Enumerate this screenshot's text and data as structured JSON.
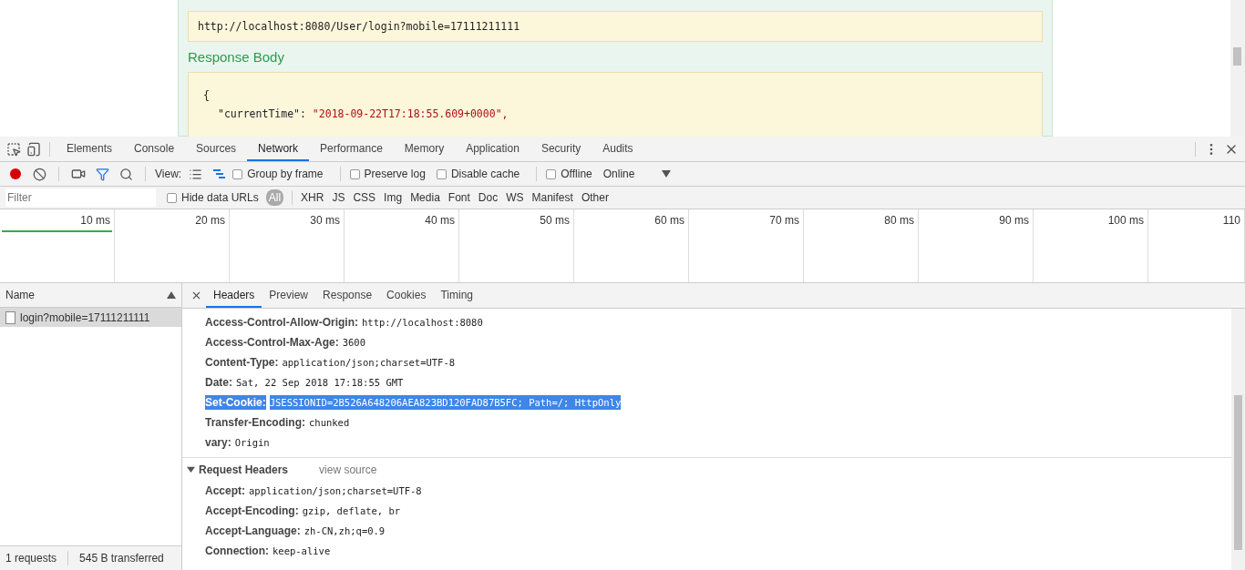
{
  "page": {
    "url": "http://localhost:8080/User/login?mobile=17111211111",
    "section_title": "Response Body",
    "code_open": "{",
    "code_key": "\"currentTime\": ",
    "code_value": "\"2018-09-22T17:18:55.609+0000\","
  },
  "devtools": {
    "tabs": [
      {
        "label": "Elements",
        "selected": false
      },
      {
        "label": "Console",
        "selected": false
      },
      {
        "label": "Sources",
        "selected": false
      },
      {
        "label": "Network",
        "selected": true
      },
      {
        "label": "Performance",
        "selected": false
      },
      {
        "label": "Memory",
        "selected": false
      },
      {
        "label": "Application",
        "selected": false
      },
      {
        "label": "Security",
        "selected": false
      },
      {
        "label": "Audits",
        "selected": false
      }
    ],
    "toolbar": {
      "recording": true,
      "filter_on": true,
      "view_label": "View:",
      "options": [
        {
          "label": "Group by frame",
          "checked": false
        },
        {
          "label": "Preserve log",
          "checked": false
        },
        {
          "label": "Disable cache",
          "checked": false
        },
        {
          "label": "Offline",
          "checked": false
        }
      ],
      "throttle": "Online"
    },
    "filter_bar": {
      "placeholder": "Filter",
      "hide_data_urls": {
        "label": "Hide data URLs",
        "checked": false
      },
      "types": [
        {
          "label": "All",
          "selected": true
        },
        {
          "label": "XHR",
          "selected": false
        },
        {
          "label": "JS",
          "selected": false
        },
        {
          "label": "CSS",
          "selected": false
        },
        {
          "label": "Img",
          "selected": false
        },
        {
          "label": "Media",
          "selected": false
        },
        {
          "label": "Font",
          "selected": false
        },
        {
          "label": "Doc",
          "selected": false
        },
        {
          "label": "WS",
          "selected": false
        },
        {
          "label": "Manifest",
          "selected": false
        },
        {
          "label": "Other",
          "selected": false
        }
      ]
    },
    "timeline": {
      "ticks": [
        "10 ms",
        "20 ms",
        "30 ms",
        "40 ms",
        "50 ms",
        "60 ms",
        "70 ms",
        "80 ms",
        "90 ms",
        "100 ms",
        "110"
      ]
    },
    "requests": {
      "column": "Name",
      "rows": [
        {
          "name": "login?mobile=17111211111",
          "selected": true
        }
      ]
    },
    "status": {
      "requests": "1 requests",
      "transferred": "545 B transferred"
    },
    "detail_tabs": [
      {
        "label": "Headers",
        "selected": true
      },
      {
        "label": "Preview",
        "selected": false
      },
      {
        "label": "Response",
        "selected": false
      },
      {
        "label": "Cookies",
        "selected": false
      },
      {
        "label": "Timing",
        "selected": false
      }
    ],
    "response_headers": [
      {
        "name": "Access-Control-Allow-Origin:",
        "value": "http://localhost:8080",
        "selected": false
      },
      {
        "name": "Access-Control-Max-Age:",
        "value": "3600",
        "selected": false
      },
      {
        "name": "Content-Type:",
        "value": "application/json;charset=UTF-8",
        "selected": false
      },
      {
        "name": "Date:",
        "value": "Sat, 22 Sep 2018 17:18:55 GMT",
        "selected": false
      },
      {
        "name": "Set-Cookie:",
        "value": "JSESSIONID=2B526A648206AEA823BD120FAD87B5FC; Path=/; HttpOnly",
        "selected": true
      },
      {
        "name": "Transfer-Encoding:",
        "value": "chunked",
        "selected": false
      },
      {
        "name": "vary:",
        "value": "Origin",
        "selected": false
      }
    ],
    "request_headers": {
      "title": "Request Headers",
      "view_source": "view source",
      "expanded": true,
      "headers": [
        {
          "name": "Accept:",
          "value": "application/json;charset=UTF-8"
        },
        {
          "name": "Accept-Encoding:",
          "value": "gzip, deflate, br"
        },
        {
          "name": "Accept-Language:",
          "value": "zh-CN,zh;q=0.9"
        },
        {
          "name": "Connection:",
          "value": "keep-alive"
        }
      ]
    }
  }
}
